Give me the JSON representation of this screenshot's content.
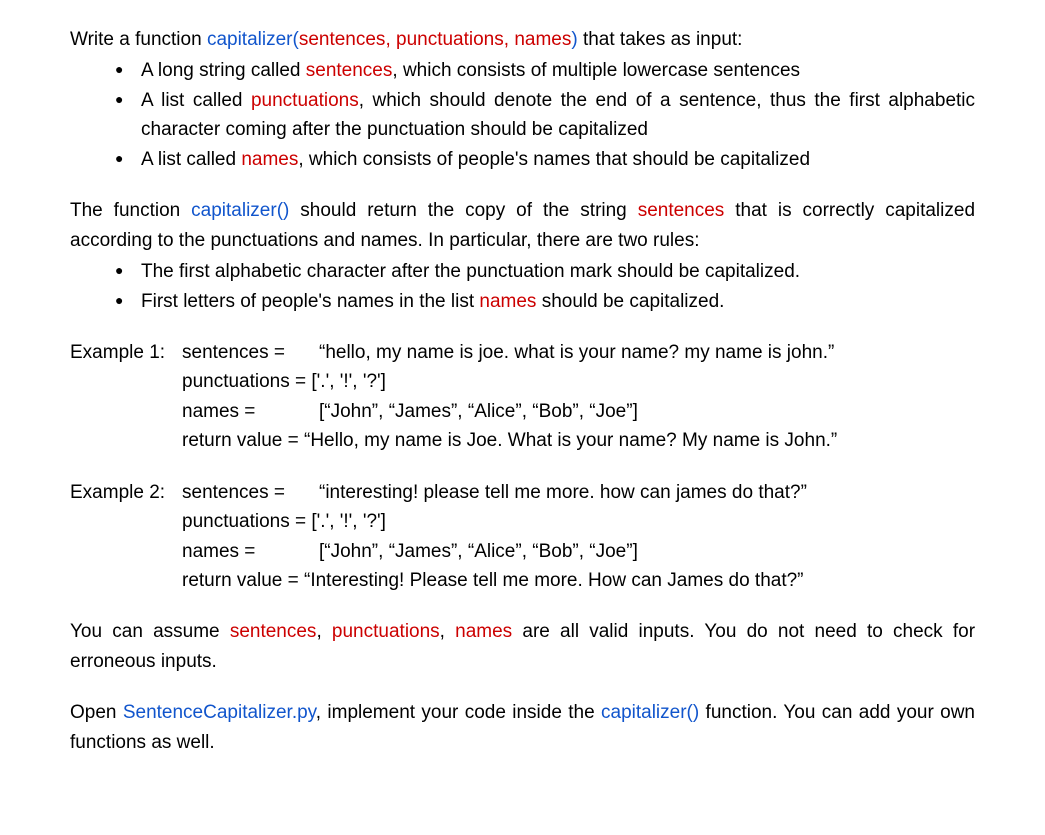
{
  "intro": {
    "prefix": "Write a function ",
    "fn_name": "capitalizer",
    "paren_open": "(",
    "arg1": "sentences",
    "comma1": ", ",
    "arg2": "punctuations",
    "comma2": ", ",
    "arg3": "names",
    "paren_close": ")",
    "suffix": " that takes as input:"
  },
  "bullets1": {
    "b1_a": "A long string called ",
    "b1_red": "sentences",
    "b1_b": ", which consists of multiple lowercase sentences",
    "b2_a": "A list called ",
    "b2_red": "punctuations",
    "b2_b": ", which should denote the end of a sentence, thus the first alphabetic character coming after the punctuation should be capitalized",
    "b3_a": "A list called ",
    "b3_red": "names",
    "b3_b": ", which consists of people's names that should be capitalized"
  },
  "rules_intro": {
    "prefix": "The function ",
    "fn": "capitalizer()",
    "mid": " should return the copy of the string ",
    "red": "sentences",
    "suffix": " that is correctly capitalized according to the punctuations and names. In particular, there are two rules:"
  },
  "bullets2": {
    "r1": "The first alphabetic character after the punctuation mark should be capitalized.",
    "r2_a": "First letters of people's names in the list ",
    "r2_red": "names",
    "r2_b": " should be capitalized."
  },
  "ex1": {
    "label": "Example 1:",
    "sentences_key": "sentences =",
    "sentences_val": "“hello, my name is joe. what is your name? my name is john.”",
    "punct_key": "punctuations =",
    "punct_val": " ['.', '!', '?']",
    "names_key": "names =",
    "names_val": "[“John”, “James”, “Alice”, “Bob”, “Joe”]",
    "return_key": "return value =",
    "return_val": " “Hello, my name is Joe. What is your name? My name is John.”"
  },
  "ex2": {
    "label": "Example 2:",
    "sentences_key": "sentences =",
    "sentences_val": "“interesting! please tell me more. how can james do that?”",
    "punct_key": "punctuations =",
    "punct_val": " ['.', '!', '?']",
    "names_key": "names =",
    "names_val": "[“John”, “James”, “Alice”, “Bob”, “Joe”]",
    "return_key": "return value =",
    "return_val": " “Interesting! Please tell me more. How can James do that?”"
  },
  "closing": {
    "prefix": "You can assume ",
    "s": "sentences",
    "c1": ", ",
    "p": "punctuations",
    "c2": ", ",
    "n": "names",
    "suffix": " are all valid inputs. You do not need to check for erroneous inputs."
  },
  "final": {
    "prefix": "Open ",
    "file": "SentenceCapitalizer.py",
    "mid": ", implement your code inside the ",
    "fn": "capitalizer()",
    "suffix": " function. You can add your own functions as well."
  }
}
